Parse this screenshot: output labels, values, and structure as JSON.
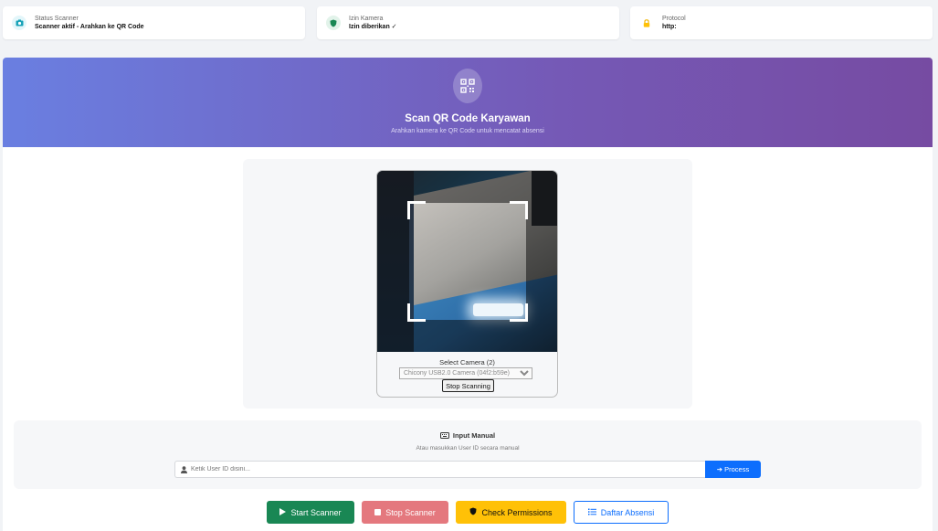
{
  "status_cards": [
    {
      "label": "Status Scanner",
      "value": "Scanner aktif - Arahkan ke QR Code",
      "icon": "camera-icon",
      "color": "#17a2b8"
    },
    {
      "label": "Izin Kamera",
      "value": "Izin diberikan ✓",
      "icon": "shield-icon",
      "color": "#198754"
    },
    {
      "label": "Protocol",
      "value": "http:",
      "icon": "lock-icon",
      "color": "#ffc107"
    }
  ],
  "hero": {
    "title": "Scan QR Code Karyawan",
    "subtitle": "Arahkan kamera ke QR Code untuk mencatat absensi",
    "icon": "qrcode-icon"
  },
  "scanner": {
    "camera_label": "Select Camera (2)",
    "camera_selected": "Chicony USB2.0 Camera (04f2:b59e)",
    "stop_label": "Stop Scanning"
  },
  "manual": {
    "title": "Input Manual",
    "title_icon": "keyboard-icon",
    "subtitle": "Atau masukkan User ID secara manual",
    "input_placeholder": "Ketik User ID disini...",
    "input_value": "",
    "input_icon": "user-icon",
    "process_label": "Process",
    "process_icon": "arrow-right-icon"
  },
  "actions": {
    "start_label": "Start Scanner",
    "stop_label": "Stop Scanner",
    "check_label": "Check Permissions",
    "list_label": "Daftar Absensi"
  },
  "colors": {
    "primary": "#0d6efd",
    "success": "#198754",
    "danger_muted": "#e4787e",
    "warning": "#ffc107",
    "gradient_start": "#667eea",
    "gradient_end": "#764ba2"
  }
}
